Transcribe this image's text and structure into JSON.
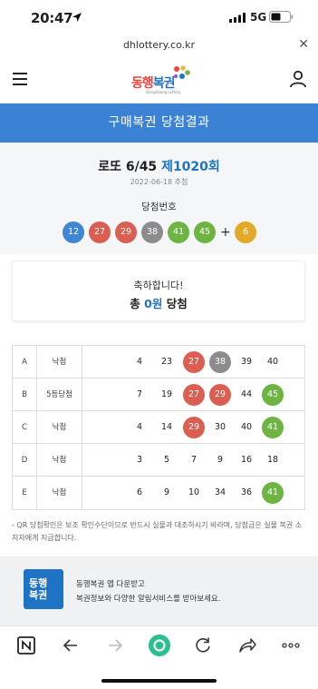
{
  "status": {
    "time": "20:47",
    "network": "5G"
  },
  "browser": {
    "url": "dhlottery.co.kr"
  },
  "nav": {
    "logo_main_1": "동행",
    "logo_main_2": "복권",
    "logo_sub": "Donghaeng Lottery"
  },
  "page_title": "구매복권 당첨결과",
  "draw": {
    "game": "로또 6/45",
    "round": "제1020회",
    "date": "2022-06-18 추첨",
    "label": "당첨번호",
    "numbers": [
      {
        "value": "12",
        "color": "#3f86d4"
      },
      {
        "value": "27",
        "color": "#db5e52"
      },
      {
        "value": "29",
        "color": "#db5e52"
      },
      {
        "value": "38",
        "color": "#8c8c8c"
      },
      {
        "value": "41",
        "color": "#6db443"
      },
      {
        "value": "45",
        "color": "#6db443"
      }
    ],
    "plus": "+",
    "bonus": {
      "value": "6",
      "color": "#e3a928"
    }
  },
  "result": {
    "message": "축하합니다!",
    "prefix": "총",
    "amount": "0원",
    "suffix": "당첨"
  },
  "tickets": [
    {
      "letter": "A",
      "result": "낙첨",
      "numbers": [
        {
          "value": "4"
        },
        {
          "value": "23"
        },
        {
          "value": "27",
          "color": "#db5e52"
        },
        {
          "value": "38",
          "color": "#8c8c8c"
        },
        {
          "value": "39"
        },
        {
          "value": "40"
        }
      ]
    },
    {
      "letter": "B",
      "result": "5등당첨",
      "numbers": [
        {
          "value": "7"
        },
        {
          "value": "19"
        },
        {
          "value": "27",
          "color": "#db5e52"
        },
        {
          "value": "29",
          "color": "#db5e52"
        },
        {
          "value": "44"
        },
        {
          "value": "45",
          "color": "#6db443"
        }
      ]
    },
    {
      "letter": "C",
      "result": "낙첨",
      "numbers": [
        {
          "value": "4"
        },
        {
          "value": "14"
        },
        {
          "value": "29",
          "color": "#db5e52"
        },
        {
          "value": "30"
        },
        {
          "value": "40"
        },
        {
          "value": "41",
          "color": "#6db443"
        }
      ]
    },
    {
      "letter": "D",
      "result": "낙첨",
      "numbers": [
        {
          "value": "3"
        },
        {
          "value": "5"
        },
        {
          "value": "7"
        },
        {
          "value": "9"
        },
        {
          "value": "16"
        },
        {
          "value": "18"
        }
      ]
    },
    {
      "letter": "E",
      "result": "낙첨",
      "numbers": [
        {
          "value": "6"
        },
        {
          "value": "9"
        },
        {
          "value": "10"
        },
        {
          "value": "34"
        },
        {
          "value": "36"
        },
        {
          "value": "41",
          "color": "#6db443"
        }
      ]
    }
  ],
  "notice": "- QR 당첨확인은 보조 확인수단이므로 반드시 실물과 대조하시기 바라며, 당첨금은 실물 복권 소지자에게 지급합니다.",
  "banner": {
    "icon_line1": "동행",
    "icon_line2": "복권",
    "line1": "동행복권 앱 다운받고",
    "line2": "복권정보와 다양한 알림서비스를 받아보세요."
  },
  "toolbar_icons": [
    "naver-n-icon",
    "back-arrow-icon",
    "forward-arrow-icon",
    "home-circle-icon",
    "reload-icon",
    "share-icon",
    "more-dots-icon"
  ]
}
